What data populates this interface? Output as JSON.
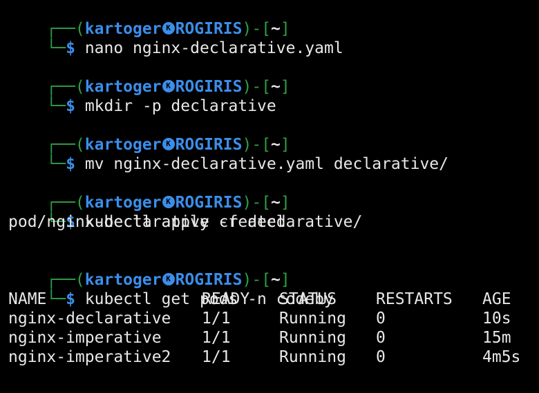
{
  "prompt": {
    "user": "kartoger",
    "host": "ROGIRIS",
    "dir": "~",
    "top_prefix": "┌──(",
    "mid": ")-[",
    "end": "]",
    "bottom_prefix": "└─",
    "dollar": "$",
    "at_icon": "K"
  },
  "commands": [
    {
      "cmd": "nano nginx-declarative.yaml",
      "output": []
    },
    {
      "cmd": "mkdir -p declarative",
      "output": []
    },
    {
      "cmd": "mv nginx-declarative.yaml declarative/",
      "output": []
    },
    {
      "cmd": "kubectl apply -f declarative/",
      "output": [
        "pod/nginx-declarative created"
      ]
    },
    {
      "cmd": "kubectl get pods -n codeby",
      "output": []
    }
  ],
  "table": {
    "headers": [
      "NAME",
      "READY",
      "STATUS",
      "RESTARTS",
      "AGE"
    ],
    "rows": [
      [
        "nginx-declarative",
        "1/1",
        "Running",
        "0",
        "10s"
      ],
      [
        "nginx-imperative",
        "1/1",
        "Running",
        "0",
        "15m"
      ],
      [
        "nginx-imperative2",
        "1/1",
        "Running",
        "0",
        "4m5s"
      ]
    ]
  },
  "colors": {
    "background": "#000000",
    "prompt_frame": "#2ea043",
    "prompt_user": "#3b8eea",
    "text": "#e8e8e8"
  }
}
